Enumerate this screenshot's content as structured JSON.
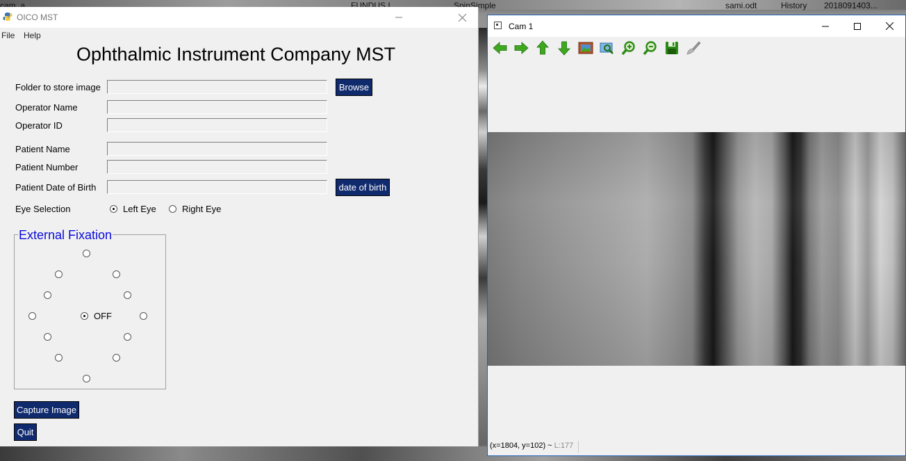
{
  "desktop": {
    "labels": [
      "cam_a",
      "FUNDUS I",
      "SpinSimple",
      "sami.odt",
      "History",
      "2018091403..."
    ]
  },
  "oico": {
    "title": "OICO MST",
    "menu": [
      "File",
      "Help"
    ],
    "heading": "Ophthalmic Instrument Company MST",
    "form": {
      "folder_label": "Folder to store image",
      "folder_value": "",
      "browse": "Browse",
      "operator_name_label": "Operator Name",
      "operator_name_value": "",
      "operator_id_label": "Operator ID",
      "operator_id_value": "",
      "patient_name_label": "Patient Name",
      "patient_name_value": "",
      "patient_number_label": "Patient Number",
      "patient_number_value": "",
      "dob_label": "Patient Date of Birth",
      "dob_value": "",
      "dob_button": "date of birth",
      "eye_label": "Eye Selection",
      "left_eye": "Left Eye",
      "right_eye": "Right Eye",
      "eye_selected": "Left Eye"
    },
    "fixation": {
      "title": "External Fixation",
      "off_label": "OFF",
      "selected": "OFF",
      "target_count": 12
    },
    "capture": "Capture Image",
    "quit": "Quit"
  },
  "cam": {
    "title": "Cam 1",
    "tools": [
      "arrow-left-icon",
      "arrow-right-icon",
      "arrow-up-icon",
      "arrow-down-icon",
      "image-icon",
      "zoom-fit-icon",
      "zoom-in-icon",
      "zoom-out-icon",
      "save-icon",
      "brush-icon"
    ],
    "status_coords": "(x=1804, y=102) ~",
    "status_level": "L:177"
  }
}
